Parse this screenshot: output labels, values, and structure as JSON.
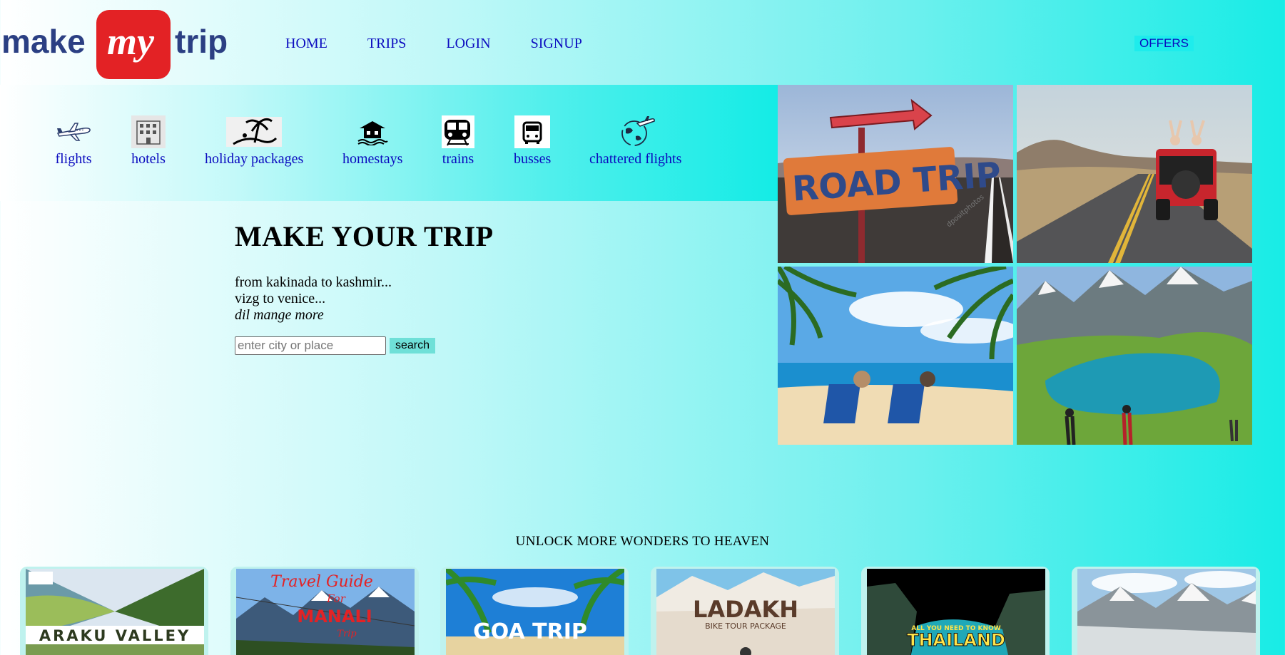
{
  "brand": {
    "logo_text_left": "make",
    "logo_text_mid": "my",
    "logo_text_right": "trip",
    "logo_red": "#e32225",
    "logo_blue": "#2b3f83"
  },
  "nav": {
    "items": [
      "HOME",
      "TRIPS",
      "LOGIN",
      "SIGNUP"
    ],
    "offers": "OFFERS"
  },
  "services": [
    {
      "label": "flights",
      "icon": "airplane-icon"
    },
    {
      "label": "hotels",
      "icon": "hotel-building-icon"
    },
    {
      "label": "holiday packages",
      "icon": "beach-palm-icon"
    },
    {
      "label": "homestays",
      "icon": "house-on-water-icon"
    },
    {
      "label": "trains",
      "icon": "train-icon"
    },
    {
      "label": "busses",
      "icon": "bus-icon"
    },
    {
      "label": "chattered flights",
      "icon": "globe-plane-icon"
    }
  ],
  "hero": {
    "title": "MAKE YOUR TRIP",
    "line1": "from kakinada to kashmir...",
    "line2": "vizg to venice...",
    "line3": "dil mange more",
    "search_placeholder": "enter city or place",
    "search_button": "search"
  },
  "photos": {
    "road_sign": "ROAD TRIP",
    "road_watermark": "dpositphotos"
  },
  "section_title": "UNLOCK MORE WONDERS TO HEAVEN",
  "destinations": {
    "araku": "ARAKU VALLEY",
    "manali_line1": "Travel Guide",
    "manali_line2": "For",
    "manali_line3": "MANALI",
    "manali_line4": "Trip",
    "goa": "GOA TRIP",
    "ladakh_title": "LADAKH",
    "ladakh_sub": "BIKE TOUR PACKAGE",
    "thailand_top": "ALL YOU NEED TO KNOW",
    "thailand": "THAILAND"
  },
  "colors": {
    "link": "#0b0bbf",
    "offers_bg": "#1eecec",
    "search_btn_bg": "#6fe0d8"
  }
}
